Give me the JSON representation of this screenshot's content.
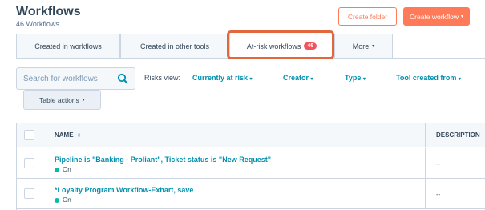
{
  "header": {
    "title": "Workflows",
    "subtitle": "46 Workflows",
    "create_folder_label": "Create folder",
    "create_workflow_label": "Create workflow",
    "create_workflow_caret": "▾"
  },
  "tabs": [
    {
      "label": "Created in workflows"
    },
    {
      "label": "Created in other tools"
    },
    {
      "label": "At-risk workflows",
      "badge": "46",
      "active": true
    },
    {
      "label": "More",
      "caret": "▾"
    }
  ],
  "search": {
    "placeholder": "Search for workflows"
  },
  "filters": {
    "risks_label": "Risks view:",
    "risk_view": "Currently at risk",
    "creator": "Creator",
    "type": "Type",
    "tool_created_from": "Tool created from",
    "caret": "▾"
  },
  "table_actions": {
    "label": "Table actions",
    "caret": "▾"
  },
  "table": {
    "columns": [
      "NAME",
      "DESCRIPTION"
    ],
    "sort_icon": "⇕",
    "rows": [
      {
        "name": "Pipeline is \"Banking - Proliant\", Ticket status is \"New Request\"",
        "status": "On",
        "description": "--"
      },
      {
        "name": "*Loyalty Program Workflow-Exhart, save",
        "status": "On",
        "description": "--"
      }
    ]
  },
  "colors": {
    "accent": "#ff7a59",
    "link": "#0091ae",
    "badge": "#f2545b",
    "highlight": "#e2673c",
    "status_on": "#00bda5"
  }
}
